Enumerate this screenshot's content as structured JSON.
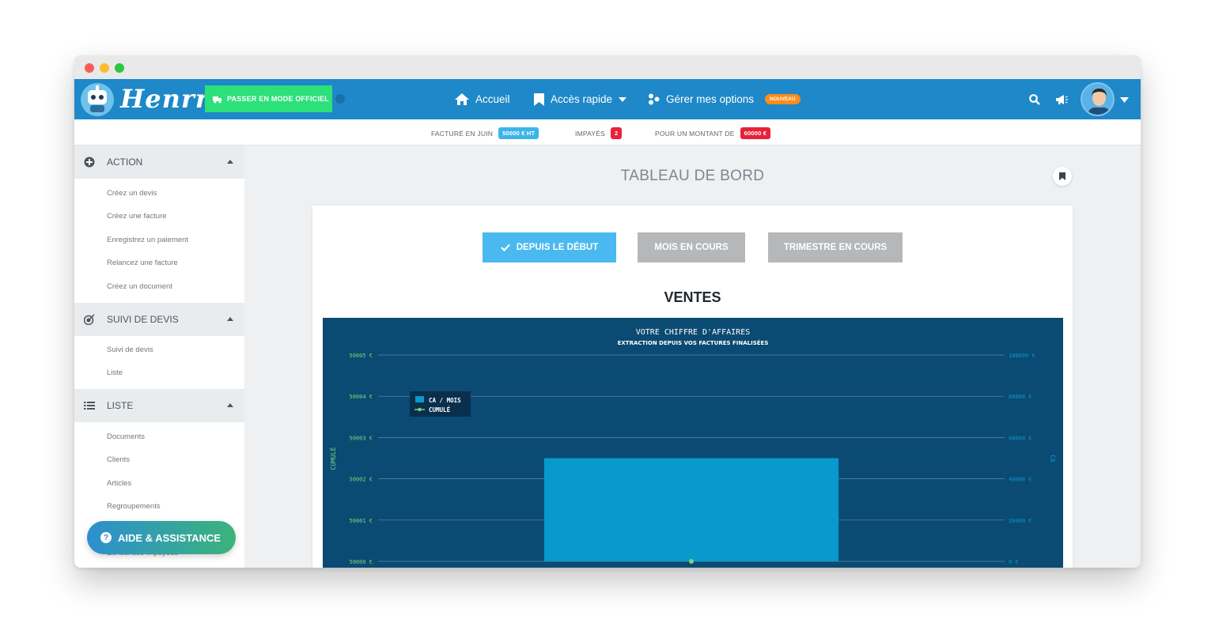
{
  "app": {
    "logo_text": "Henrri",
    "mode_button": "PASSER EN MODE OFFICIEL"
  },
  "nav": {
    "accueil": "Accueil",
    "acces_rapide": "Accès rapide",
    "options": "Gérer mes options",
    "options_badge": "NOUVEAU"
  },
  "icons": [
    "home-icon",
    "bookmark-icon",
    "caret-down-icon",
    "options-icon",
    "search-icon",
    "megaphone-icon",
    "avatar",
    "plus-circle-icon",
    "target-icon",
    "list-icon",
    "question-icon",
    "check-icon"
  ],
  "stats": {
    "facture_label": "FACTURÉ EN JUIN",
    "facture_value": "50000 € HT",
    "impayes_label": "IMPAYÉS",
    "impayes_value": "2",
    "montant_label": "POUR UN MONTANT DE",
    "montant_value": "60000 €"
  },
  "colors": {
    "nav_bg": "#1e88c8",
    "accent_green": "#2ce07a",
    "accent_blue": "#4ab9ef",
    "badge_red": "#e8213a",
    "chart_bg": "#0b4a72",
    "bar": "#0899cd",
    "cumul": "#7ed37e"
  },
  "sidebar": {
    "sections": [
      {
        "label": "ACTION",
        "items": [
          "Créez un devis",
          "Créez une facture",
          "Enregistrez un paiement",
          "Relancez une facture",
          "Créez un document"
        ]
      },
      {
        "label": "SUIVI DE DEVIS",
        "items": [
          "Suivi de devis",
          "Liste"
        ]
      },
      {
        "label": "LISTE",
        "items": [
          "Documents",
          "Clients",
          "Articles",
          "Regroupements",
          "Échéances impayées"
        ]
      }
    ],
    "aide": "AIDE & ASSISTANCE"
  },
  "main": {
    "title": "TABLEAU DE BORD",
    "tabs": [
      "DEPUIS LE DÉBUT",
      "MOIS EN COURS",
      "TRIMESTRE EN COURS"
    ],
    "active_tab": 0,
    "section_title": "VENTES"
  },
  "chart_data": {
    "type": "bar",
    "title": "VOTRE CHIFFRE D'AFFAIRES",
    "subtitle": "EXTRACTION DEPUIS VOS FACTURES FINALISÉES",
    "categories": [
      ""
    ],
    "series": [
      {
        "name": "CA / MOIS",
        "type": "bar",
        "axis": "right",
        "values": [
          50000
        ]
      },
      {
        "name": "CUMULÉ",
        "type": "line",
        "axis": "left",
        "values": [
          50000
        ]
      }
    ],
    "left_axis": {
      "label": "CUMULÉ",
      "ticks": [
        "50000 €",
        "50001 €",
        "50002 €",
        "50003 €",
        "50004 €",
        "50005 €"
      ],
      "ylim": [
        50000,
        50005
      ]
    },
    "right_axis": {
      "label": "CA",
      "ticks": [
        "0 €",
        "20000 €",
        "40000 €",
        "60000 €",
        "80000 €",
        "100000 €"
      ],
      "ylim": [
        0,
        100000
      ]
    },
    "grid": true,
    "legend": "top-left"
  }
}
